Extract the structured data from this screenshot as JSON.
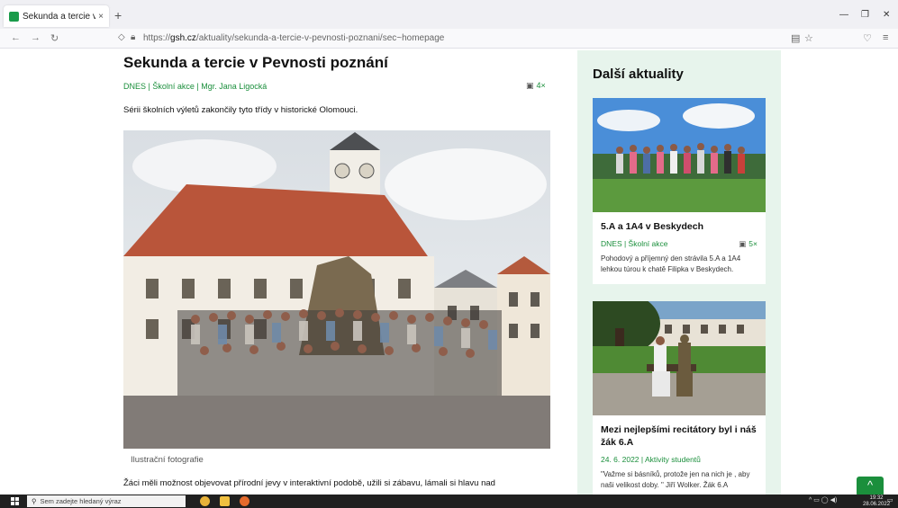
{
  "browser": {
    "tab_title": "Sekunda a tercie v Pevn…",
    "tab_close": "×",
    "new_tab": "+",
    "url_prefix": "https://",
    "url_domain": "gsh.cz",
    "url_path": "/aktuality/sekunda-a-tercie-v-pevnosti-poznani/sec~homepage",
    "icons": [
      "back-icon",
      "forward-icon",
      "reload-icon",
      "shield-icon",
      "lock-icon",
      "reader-icon",
      "bookmark-star-icon",
      "pocket-icon",
      "menu-icon"
    ]
  },
  "article": {
    "title": "Sekunda a tercie v Pevnosti poznání",
    "meta": "DNES | Školní akce | Mgr. Jana Ligocká",
    "photo_count": "4×",
    "lead": "Sérii školních výletů zakončily tyto třídy v historické Olomouci.",
    "caption": "Ilustrační fotografie",
    "body_line1": "Žáci měli možnost objevovat přírodní jevy v interaktivní podobě, užili si zábavu, lámali si hlavu nad"
  },
  "sidebar": {
    "heading": "Další aktuality",
    "cards": [
      {
        "title": "5.A a 1A4 v Beskydech",
        "meta": "DNES | Školní akce",
        "photo_count": "5×",
        "text": "Pohodový a příjemný den strávila 5.A a 1A4 lehkou túrou k chatě Filipka v Beskydech."
      },
      {
        "title": "Mezi nejlepšími recitátory byl i náš žák 6.A",
        "meta": "24. 6. 2022 | Aktivity studentů",
        "text": "\"Važme si básníků, protože jen na nich je , aby naši velikost doby. \" Jiří Wolker. Žák 6.A"
      }
    ]
  },
  "scroll_top": "^",
  "taskbar": {
    "search_placeholder": "Sem zadejte hledaný výraz",
    "time": "19:32",
    "date": "28.06.2022"
  },
  "colors": {
    "accent_green": "#1b8f3c",
    "sidebar_bg": "#e7f4ec"
  }
}
